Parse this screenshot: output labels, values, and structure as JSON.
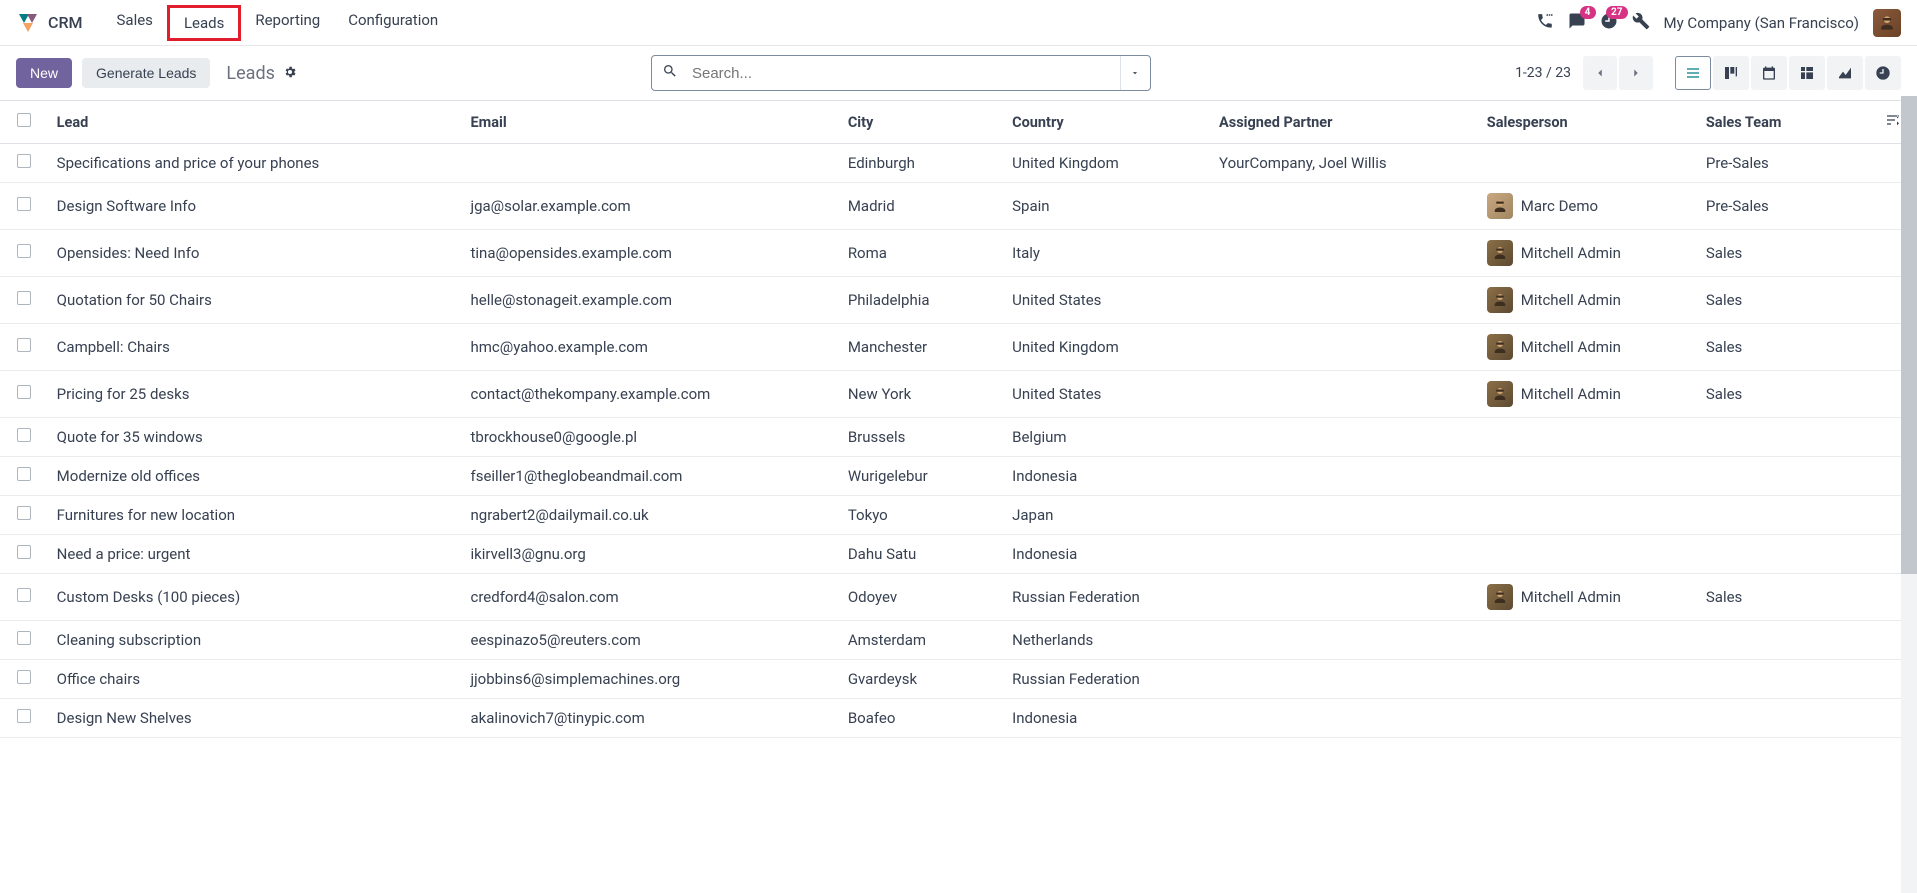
{
  "app": {
    "name": "CRM"
  },
  "nav": {
    "items": [
      "Sales",
      "Leads",
      "Reporting",
      "Configuration"
    ],
    "highlighted_index": 1
  },
  "topright": {
    "msg_badge": "4",
    "activity_badge": "27",
    "company": "My Company (San Francisco)"
  },
  "toolbar": {
    "new_label": "New",
    "generate_label": "Generate Leads",
    "breadcrumb": "Leads"
  },
  "search": {
    "placeholder": "Search..."
  },
  "pager": {
    "text": "1-23 / 23"
  },
  "columns": {
    "lead": "Lead",
    "email": "Email",
    "city": "City",
    "country": "Country",
    "partner": "Assigned Partner",
    "salesperson": "Salesperson",
    "team": "Sales Team"
  },
  "rows": [
    {
      "lead": "Specifications and price of your phones",
      "email": "",
      "city": "Edinburgh",
      "country": "United Kingdom",
      "partner": "YourCompany, Joel Willis",
      "salesperson": "",
      "team": "Pre-Sales",
      "avatar": ""
    },
    {
      "lead": "Design Software Info",
      "email": "jga@solar.example.com",
      "city": "Madrid",
      "country": "Spain",
      "partner": "",
      "salesperson": "Marc Demo",
      "team": "Pre-Sales",
      "avatar": "alt"
    },
    {
      "lead": "Opensides: Need Info",
      "email": "tina@opensides.example.com",
      "city": "Roma",
      "country": "Italy",
      "partner": "",
      "salesperson": "Mitchell Admin",
      "team": "Sales",
      "avatar": "std"
    },
    {
      "lead": "Quotation for 50 Chairs",
      "email": "helle@stonageit.example.com",
      "city": "Philadelphia",
      "country": "United States",
      "partner": "",
      "salesperson": "Mitchell Admin",
      "team": "Sales",
      "avatar": "std"
    },
    {
      "lead": "Campbell: Chairs",
      "email": "hmc@yahoo.example.com",
      "city": "Manchester",
      "country": "United Kingdom",
      "partner": "",
      "salesperson": "Mitchell Admin",
      "team": "Sales",
      "avatar": "std"
    },
    {
      "lead": "Pricing for 25 desks",
      "email": "contact@thekompany.example.com",
      "city": "New York",
      "country": "United States",
      "partner": "",
      "salesperson": "Mitchell Admin",
      "team": "Sales",
      "avatar": "std"
    },
    {
      "lead": "Quote for 35 windows",
      "email": "tbrockhouse0@google.pl",
      "city": "Brussels",
      "country": "Belgium",
      "partner": "",
      "salesperson": "",
      "team": "",
      "avatar": ""
    },
    {
      "lead": "Modernize old offices",
      "email": "fseiller1@theglobeandmail.com",
      "city": "Wurigelebur",
      "country": "Indonesia",
      "partner": "",
      "salesperson": "",
      "team": "",
      "avatar": ""
    },
    {
      "lead": "Furnitures for new location",
      "email": "ngrabert2@dailymail.co.uk",
      "city": "Tokyo",
      "country": "Japan",
      "partner": "",
      "salesperson": "",
      "team": "",
      "avatar": ""
    },
    {
      "lead": "Need a price: urgent",
      "email": "ikirvell3@gnu.org",
      "city": "Dahu Satu",
      "country": "Indonesia",
      "partner": "",
      "salesperson": "",
      "team": "",
      "avatar": ""
    },
    {
      "lead": "Custom Desks (100 pieces)",
      "email": "credford4@salon.com",
      "city": "Odoyev",
      "country": "Russian Federation",
      "partner": "",
      "salesperson": "Mitchell Admin",
      "team": "Sales",
      "avatar": "std"
    },
    {
      "lead": "Cleaning subscription",
      "email": "eespinazo5@reuters.com",
      "city": "Amsterdam",
      "country": "Netherlands",
      "partner": "",
      "salesperson": "",
      "team": "",
      "avatar": ""
    },
    {
      "lead": "Office chairs",
      "email": "jjobbins6@simplemachines.org",
      "city": "Gvardeysk",
      "country": "Russian Federation",
      "partner": "",
      "salesperson": "",
      "team": "",
      "avatar": ""
    },
    {
      "lead": "Design New Shelves",
      "email": "akalinovich7@tinypic.com",
      "city": "Boafeo",
      "country": "Indonesia",
      "partner": "",
      "salesperson": "",
      "team": "",
      "avatar": ""
    }
  ]
}
